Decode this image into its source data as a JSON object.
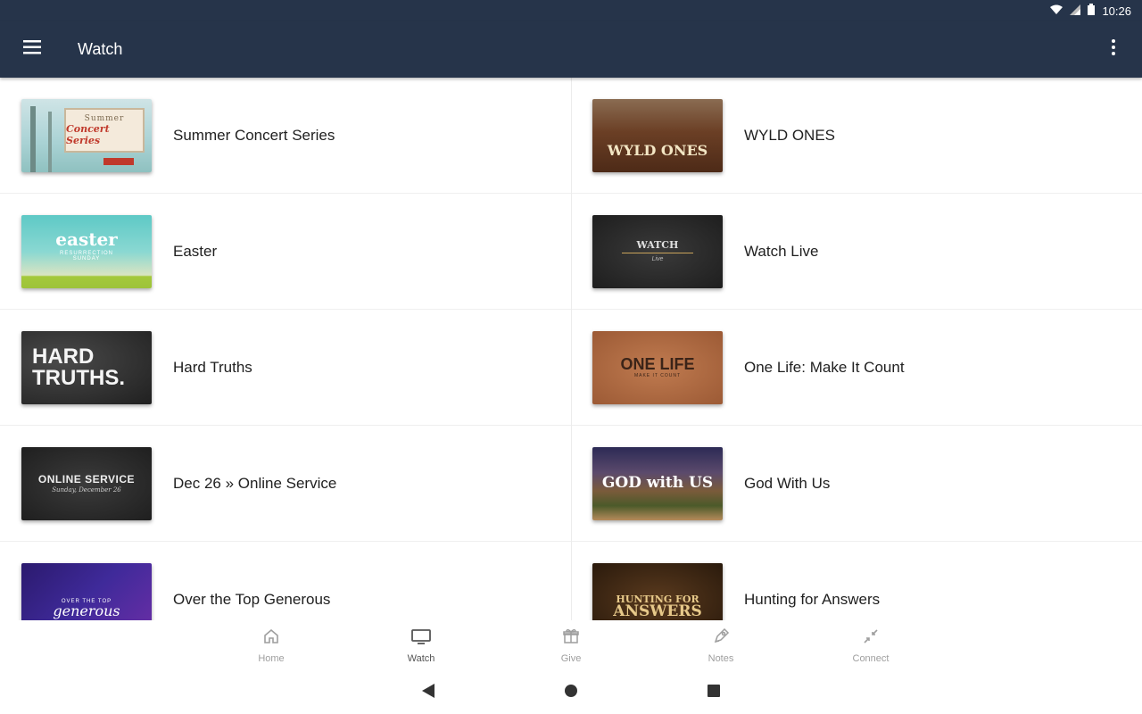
{
  "status": {
    "time": "10:26"
  },
  "appbar": {
    "title": "Watch"
  },
  "items": [
    {
      "label": "Summer Concert Series",
      "thumb_line1": "Summer",
      "thumb_line2": "Concert Series"
    },
    {
      "label": "WYLD ONES",
      "thumb_line1": "WYLD ONES",
      "thumb_line2": ""
    },
    {
      "label": "Easter",
      "thumb_line1": "easter",
      "thumb_line2": "RESURRECTION SUNDAY"
    },
    {
      "label": "Watch Live",
      "thumb_line1": "WATCH",
      "thumb_line2": "Live"
    },
    {
      "label": "Hard Truths",
      "thumb_line1": "HARD",
      "thumb_line2": "TRUTHS."
    },
    {
      "label": "One Life: Make It Count",
      "thumb_line1": "ONE LIFE",
      "thumb_line2": "MAKE IT COUNT"
    },
    {
      "label": "Dec 26 » Online Service",
      "thumb_line1": "ONLINE SERVICE",
      "thumb_line2": "Sunday, December 26"
    },
    {
      "label": "God With Us",
      "thumb_line1": "GOD with US",
      "thumb_line2": ""
    },
    {
      "label": "Over the Top Generous",
      "thumb_line1": "OVER THE TOP",
      "thumb_line2": "generous"
    },
    {
      "label": "Hunting for Answers",
      "thumb_line1": "HUNTING FOR",
      "thumb_line2": "ANSWERS"
    }
  ],
  "bottomnav": [
    {
      "label": "Home",
      "icon": "home-icon"
    },
    {
      "label": "Watch",
      "icon": "tv-icon"
    },
    {
      "label": "Give",
      "icon": "gift-icon"
    },
    {
      "label": "Notes",
      "icon": "notes-icon"
    },
    {
      "label": "Connect",
      "icon": "connect-icon"
    }
  ],
  "colors": {
    "appbar": "#26344a",
    "active_tab": "#555555",
    "inactive_tab": "#9e9e9e"
  }
}
